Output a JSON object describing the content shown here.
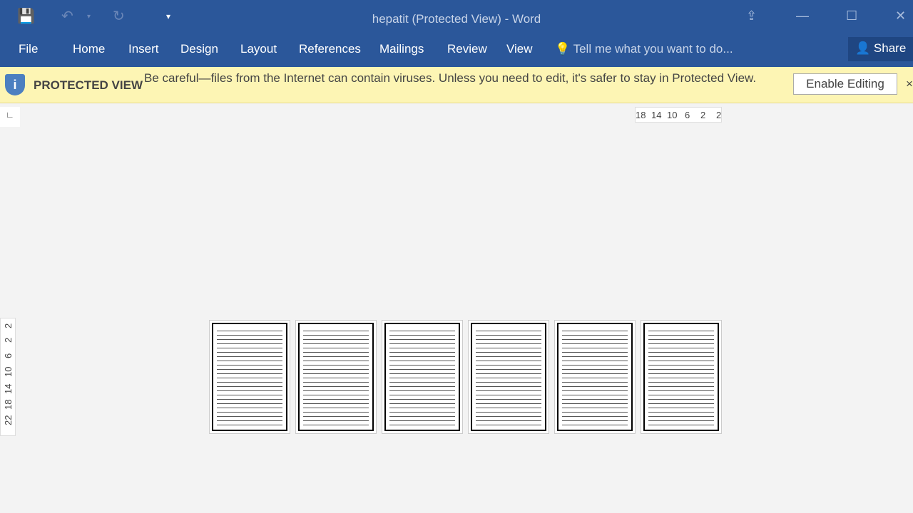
{
  "window": {
    "title": "hepatit (Protected View) - Word"
  },
  "qat": {
    "save": "save-icon",
    "undo": "undo-icon",
    "redo": "redo-icon",
    "customize": "customize-icon"
  },
  "ribbon": {
    "tabs": [
      "File",
      "Home",
      "Insert",
      "Design",
      "Layout",
      "References",
      "Mailings",
      "Review",
      "View"
    ],
    "tell_me": "Tell me what you want to do...",
    "share": "Share"
  },
  "protected_view": {
    "label": "PROTECTED VIEW",
    "message": "Be careful—files from the Internet can contain viruses. Unless you need to edit, it's safer to stay in Protected View.",
    "enable_button": "Enable Editing",
    "close": "×"
  },
  "hruler": [
    "18",
    "14",
    "10",
    "6",
    "2",
    "2"
  ],
  "vruler": [
    "2",
    "2",
    "6",
    "10",
    "14",
    "18",
    "22"
  ],
  "pages": 6,
  "colors": {
    "ribbon": "#2b579a",
    "banner": "#fdf5b4"
  }
}
